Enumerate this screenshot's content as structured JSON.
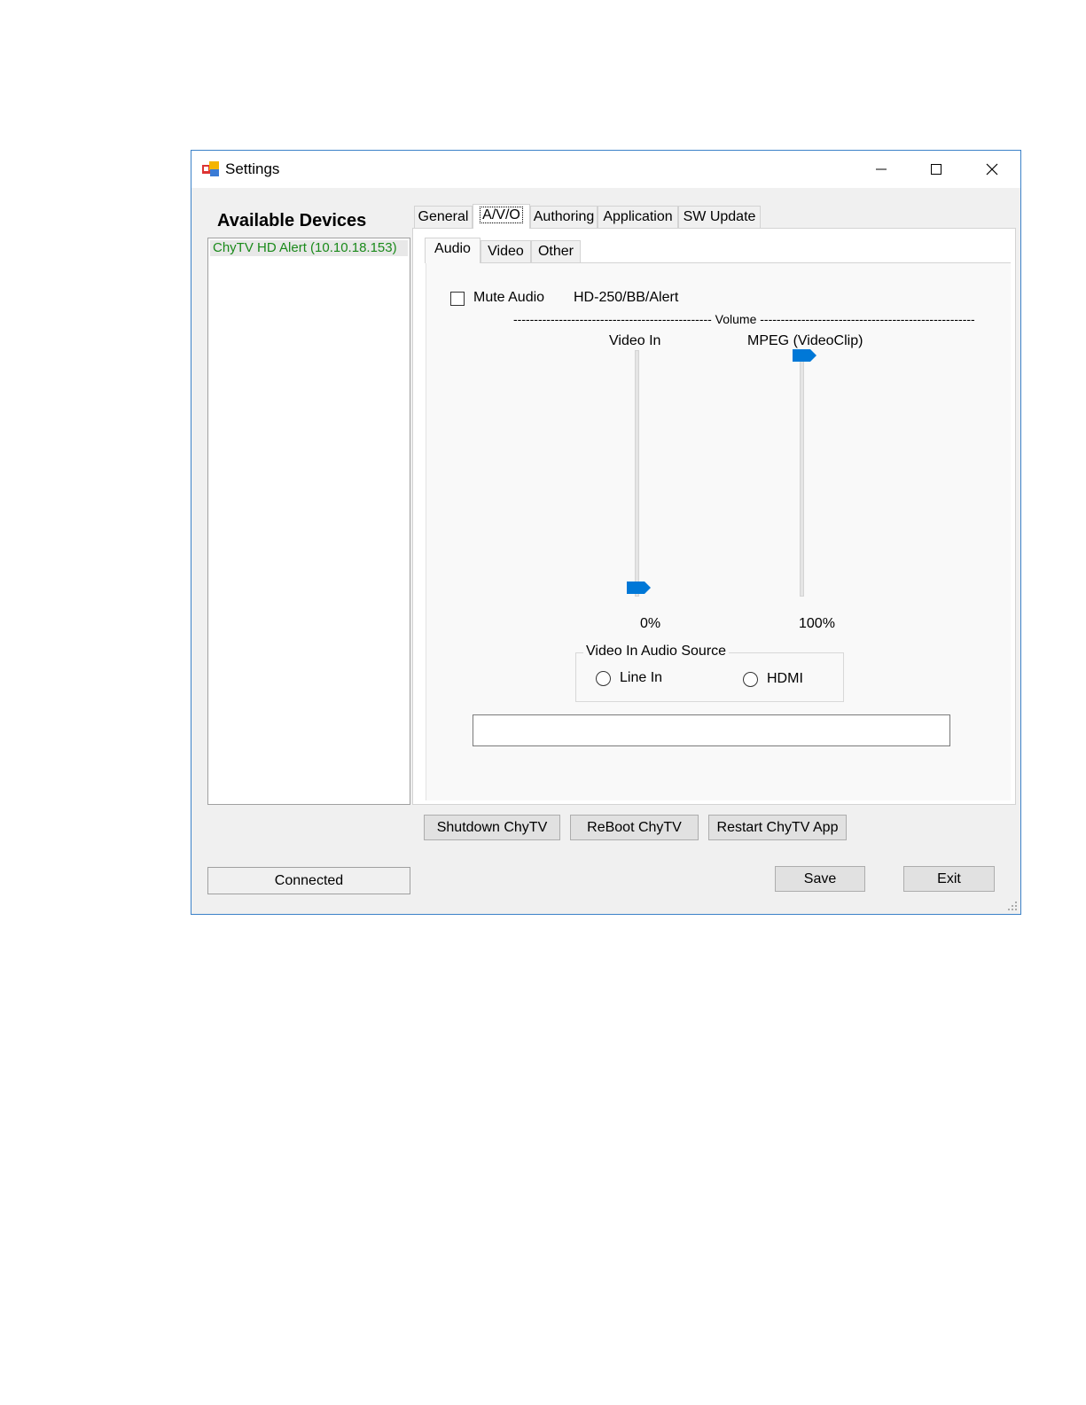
{
  "window": {
    "title": "Settings"
  },
  "titlebar": {
    "minimize_icon": "minimize-icon",
    "maximize_icon": "maximize-icon",
    "close_icon": "close-icon"
  },
  "devices": {
    "title": "Available Devices",
    "items": [
      {
        "label": "ChyTV HD Alert (10.10.18.153)",
        "color": "#1a8a1a"
      }
    ]
  },
  "tabs": [
    {
      "label": "General"
    },
    {
      "label": "A/V/O",
      "active": true
    },
    {
      "label": "Authoring"
    },
    {
      "label": "Application"
    },
    {
      "label": "SW Update"
    }
  ],
  "subtabs": [
    {
      "label": "Audio",
      "active": true
    },
    {
      "label": "Video"
    },
    {
      "label": "Other"
    }
  ],
  "audio": {
    "mute_label": "Mute Audio",
    "mute_checked": false,
    "model_label": "HD-250/BB/Alert",
    "volume_header": "------------------------------------------------ Volume ----------------------------------------------------",
    "video_in": {
      "label": "Video In",
      "value_label": "0%",
      "level": 0
    },
    "mpeg": {
      "label": "MPEG (VideoClip)",
      "value_label": "100%",
      "level": 1
    },
    "source_group": {
      "title": "Video In Audio Source",
      "options": [
        "Line In",
        "HDMI"
      ]
    },
    "status_text": ""
  },
  "actions": {
    "shutdown": "Shutdown ChyTV",
    "reboot": "ReBoot ChyTV",
    "restart": "Restart ChyTV App"
  },
  "footer": {
    "status": "Connected",
    "save": "Save",
    "exit": "Exit"
  },
  "colors": {
    "accent": "#0078d7",
    "window_border": "#3c82c8",
    "device_text": "#1a8a1a"
  }
}
